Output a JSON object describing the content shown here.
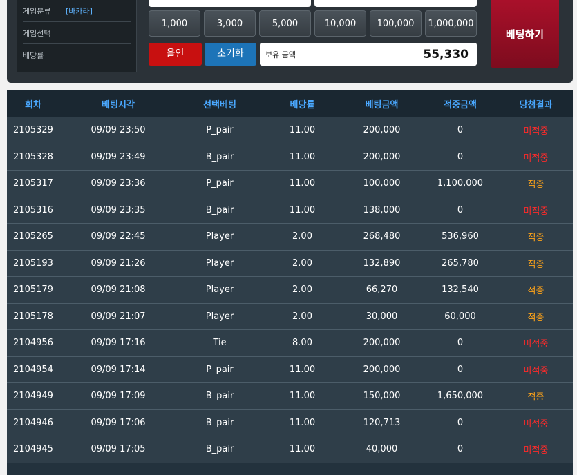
{
  "info": {
    "rows": [
      {
        "label": "게임분류",
        "value": "[바카라]"
      },
      {
        "label": "게임선택",
        "value": ""
      },
      {
        "label": "배당률",
        "value": ""
      }
    ]
  },
  "chips": [
    "1,000",
    "3,000",
    "5,000",
    "10,000",
    "100,000",
    "1,000,000"
  ],
  "buttons": {
    "allin": "올인",
    "reset": "초기화",
    "bet": "베팅하기"
  },
  "balance": {
    "label": "보유 금액",
    "amount": "55,330"
  },
  "table": {
    "headers": [
      "회차",
      "베팅시각",
      "선택베팅",
      "배당률",
      "베팅금액",
      "적중금액",
      "당첨결과"
    ],
    "rows": [
      [
        "2105329",
        "09/09 23:50",
        "P_pair",
        "11.00",
        "200,000",
        "0",
        "미적중"
      ],
      [
        "2105328",
        "09/09 23:49",
        "B_pair",
        "11.00",
        "200,000",
        "0",
        "미적중"
      ],
      [
        "2105317",
        "09/09 23:36",
        "P_pair",
        "11.00",
        "100,000",
        "1,100,000",
        "적중"
      ],
      [
        "2105316",
        "09/09 23:35",
        "B_pair",
        "11.00",
        "138,000",
        "0",
        "미적중"
      ],
      [
        "2105265",
        "09/09 22:45",
        "Player",
        "2.00",
        "268,480",
        "536,960",
        "적중"
      ],
      [
        "2105193",
        "09/09 21:26",
        "Player",
        "2.00",
        "132,890",
        "265,780",
        "적중"
      ],
      [
        "2105179",
        "09/09 21:08",
        "Player",
        "2.00",
        "66,270",
        "132,540",
        "적중"
      ],
      [
        "2105178",
        "09/09 21:07",
        "Player",
        "2.00",
        "30,000",
        "60,000",
        "적중"
      ],
      [
        "2104956",
        "09/09 17:16",
        "Tie",
        "8.00",
        "200,000",
        "0",
        "미적중"
      ],
      [
        "2104954",
        "09/09 17:14",
        "P_pair",
        "11.00",
        "200,000",
        "0",
        "미적중"
      ],
      [
        "2104949",
        "09/09 17:09",
        "B_pair",
        "11.00",
        "150,000",
        "1,650,000",
        "적중"
      ],
      [
        "2104946",
        "09/09 17:06",
        "B_pair",
        "11.00",
        "120,713",
        "0",
        "미적중"
      ],
      [
        "2104945",
        "09/09 17:05",
        "B_pair",
        "11.00",
        "40,000",
        "0",
        "미적중"
      ]
    ]
  },
  "colors": {
    "win": "#ffa318",
    "lose": "#ff2a2a",
    "header_text": "#4aa8ff"
  }
}
